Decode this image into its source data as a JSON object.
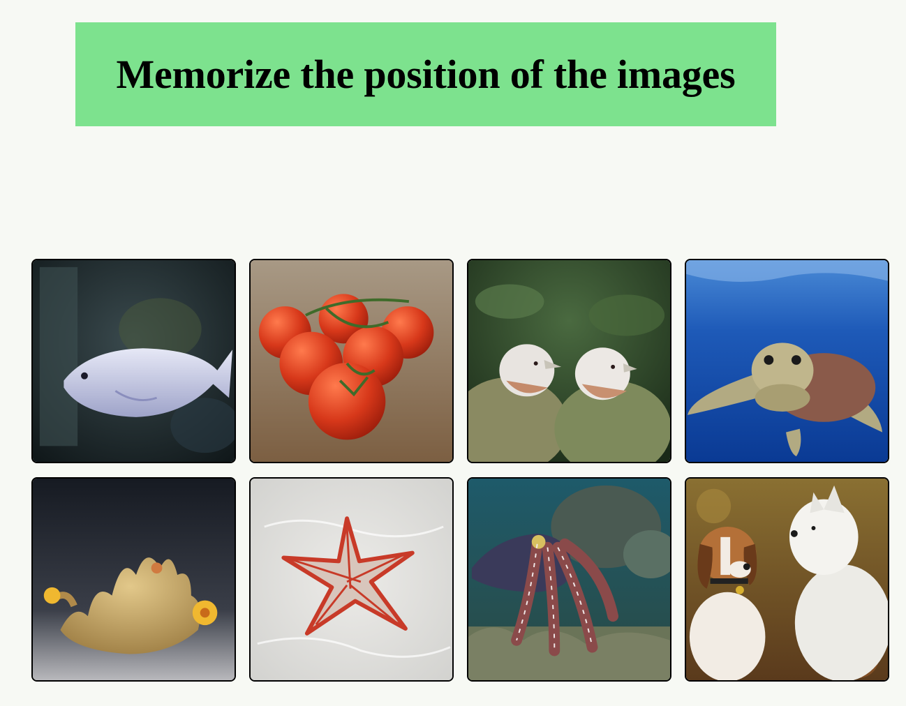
{
  "header": {
    "title": "Memorize the position of the images"
  },
  "colors": {
    "banner_bg": "#7de28e",
    "page_bg": "#f7f9f4",
    "card_border": "#000000"
  },
  "cards": [
    {
      "subject": "fish"
    },
    {
      "subject": "tomatoes"
    },
    {
      "subject": "pigeons"
    },
    {
      "subject": "sea-turtle"
    },
    {
      "subject": "ginger"
    },
    {
      "subject": "starfish"
    },
    {
      "subject": "cuttlefish"
    },
    {
      "subject": "dogs"
    }
  ]
}
